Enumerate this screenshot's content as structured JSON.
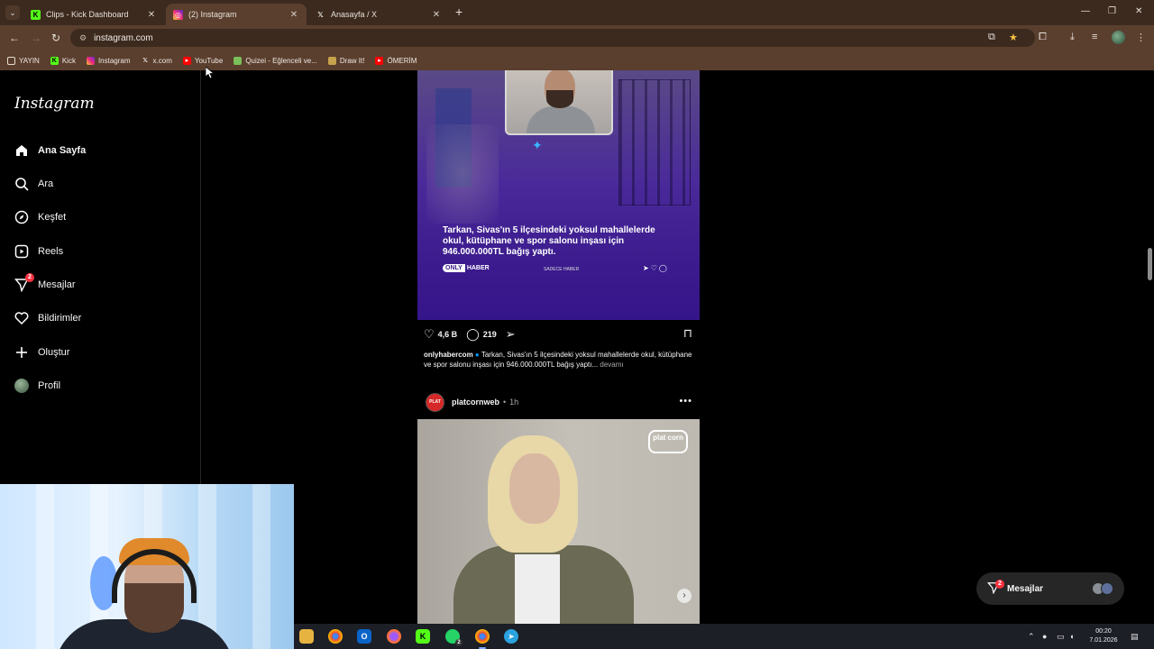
{
  "browser": {
    "tabs": [
      {
        "title": "Clips - Kick Dashboard",
        "favicon": "kick-icon",
        "active": false
      },
      {
        "title": "(2) Instagram",
        "favicon": "instagram-icon",
        "active": true
      },
      {
        "title": "Anasayfa / X",
        "favicon": "x-icon",
        "active": false
      }
    ],
    "url": "instagram.com",
    "bookmarks": [
      {
        "label": "YAYIN",
        "icon": "folder-icon"
      },
      {
        "label": "Kick",
        "icon": "kick-icon"
      },
      {
        "label": "Instagram",
        "icon": "instagram-icon"
      },
      {
        "label": "x.com",
        "icon": "x-icon"
      },
      {
        "label": "YouTube",
        "icon": "youtube-icon"
      },
      {
        "label": "Quizei - Eğlenceli ve...",
        "icon": "quizei-icon"
      },
      {
        "label": "Draw It!",
        "icon": "draw-icon"
      },
      {
        "label": "ÖMERİM",
        "icon": "youtube-icon"
      }
    ]
  },
  "instagram": {
    "logo": "Instagram",
    "nav": [
      {
        "label": "Ana Sayfa",
        "icon": "home-icon"
      },
      {
        "label": "Ara",
        "icon": "search-icon"
      },
      {
        "label": "Keşfet",
        "icon": "compass-icon"
      },
      {
        "label": "Reels",
        "icon": "reels-icon"
      },
      {
        "label": "Mesajlar",
        "icon": "messenger-icon",
        "badge": "2"
      },
      {
        "label": "Bildirimler",
        "icon": "heart-icon"
      },
      {
        "label": "Oluştur",
        "icon": "plus-icon"
      },
      {
        "label": "Profil",
        "icon": "avatar"
      }
    ],
    "post1": {
      "image_headline": "Tarkan, Sivas'ın 5 ilçesindeki yoksul mahallelerde okul, kütüphane ve spor salonu inşası için 946.000.000TL bağış yaptı.",
      "image_brand_only": "ONLY",
      "image_brand_haber": "HABER",
      "image_tagline": "SADECE HABER",
      "likes": "4,6 B",
      "comments": "219",
      "caption_user": "onlyhabercom",
      "caption_text": "Tarkan, Sivas'ın 5 ilçesindeki yoksul mahallelerde okul, kütüphane ve spor salonu inşası için 946.000.000TL bağış yaptı...",
      "more": "devamı"
    },
    "post2": {
      "avatar_text": "PLAT",
      "user": "platcornweb",
      "time": "1h",
      "logo_text": "plat corn"
    },
    "messages_pill": {
      "label": "Mesajlar",
      "badge": "2"
    }
  },
  "taskbar": {
    "time": "00:20",
    "date": "7.01.2026",
    "whatsapp_badge": "2"
  }
}
